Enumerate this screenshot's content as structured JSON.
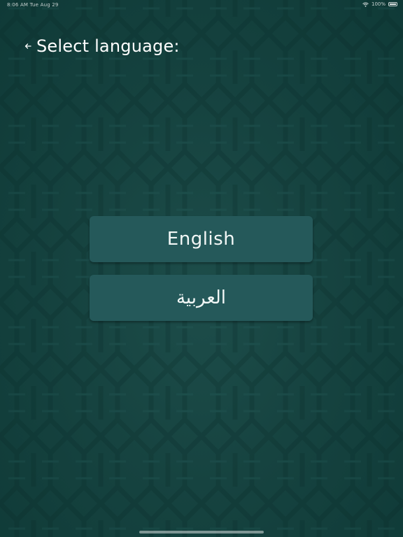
{
  "status_bar": {
    "time_date": "8:06 AM   Tue Aug 29",
    "battery": "100%",
    "icons": [
      "wifi-icon",
      "battery-icon"
    ]
  },
  "header": {
    "back_icon": "back-arrow-icon",
    "title": "Select language:"
  },
  "languages": [
    {
      "label": "English"
    },
    {
      "label": "العربية"
    }
  ],
  "colors": {
    "background": "#164340",
    "button": "#25595a",
    "text": "#ffffff"
  }
}
